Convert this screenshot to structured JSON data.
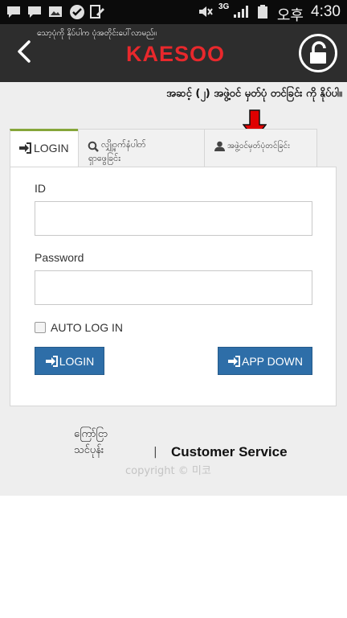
{
  "status_bar": {
    "network": "3G",
    "carrier_text": "오후",
    "time": "4:30",
    "icons": [
      "chat-icon",
      "chat-icon",
      "image-icon",
      "check-icon",
      "edit-icon",
      "mute-icon",
      "signal-icon",
      "battery-icon"
    ]
  },
  "header": {
    "notice": "သော့ပုံကို နိုပ်ပါက ပုံအတိုင်းပေါ်လာမည်။",
    "logo": "KAESOO",
    "back_icon": "chevron-left-icon",
    "lock_icon": "lock-icon"
  },
  "instruction": "အဆင့် (၂) အဖွဲ့ဝင် မှတ်ပုံ တင်ခြင်း ကို နိုပ်ပါ။",
  "tabs": [
    {
      "label": "LOGIN",
      "icon": "sign-in-icon",
      "active": true
    },
    {
      "label_line1": "လျှို့ဝှက်နံပါတ်",
      "label_line2": "ရှာဖွေခြင်း",
      "icon": "search-icon",
      "active": false
    },
    {
      "label": "အဖွဲ့ဝင်မှတ်ပုံတင်ခြင်း",
      "icon": "user-icon",
      "active": false
    }
  ],
  "form": {
    "id_label": "ID",
    "id_value": "",
    "password_label": "Password",
    "password_value": "",
    "auto_login_label": "AUTO LOG IN",
    "auto_login_checked": false,
    "login_button": "LOGIN",
    "appdown_button": "APP DOWN"
  },
  "footer": {
    "contact_line1": "ကြော်ငြာ",
    "contact_line2": "သင်ပုန်း",
    "separator": "|",
    "customer_service": "Customer Service",
    "copyright": "copyright © 미코"
  },
  "colors": {
    "header_bg": "#2d2d2d",
    "logo": "#e8282c",
    "button": "#2e6ea8",
    "active_tab_accent": "#86a63a",
    "arrow": "#e00000"
  }
}
